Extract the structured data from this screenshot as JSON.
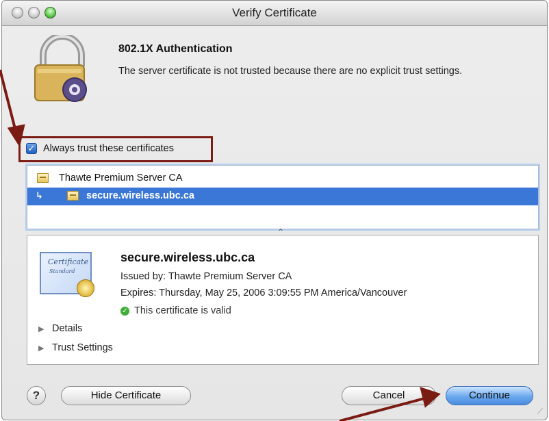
{
  "window": {
    "title": "Verify Certificate"
  },
  "dialog": {
    "heading": "802.1X Authentication",
    "message": "The server certificate is not trusted because there are no explicit trust settings."
  },
  "trust_checkbox": {
    "label": "Always trust these certificates",
    "checked": true
  },
  "cert_tree": {
    "items": [
      {
        "label": "Thawte Premium Server CA",
        "selected": false
      },
      {
        "label": "secure.wireless.ubc.ca",
        "selected": true
      }
    ]
  },
  "cert_details": {
    "name": "secure.wireless.ubc.ca",
    "issued_by": "Issued by: Thawte Premium Server CA",
    "expires": "Expires: Thursday, May 25, 2006 3:09:55 PM America/Vancouver",
    "status": "This certificate is valid",
    "badge_title": "Certificate",
    "badge_subtitle": "Standard",
    "sections": [
      "Details",
      "Trust Settings"
    ]
  },
  "buttons": {
    "help": "?",
    "hide_certificate": "Hide Certificate",
    "cancel": "Cancel",
    "continue": "Continue"
  },
  "colors": {
    "annotation": "#7a1b14",
    "selection": "#3a77d6",
    "default_button": "#4b8ce0"
  }
}
